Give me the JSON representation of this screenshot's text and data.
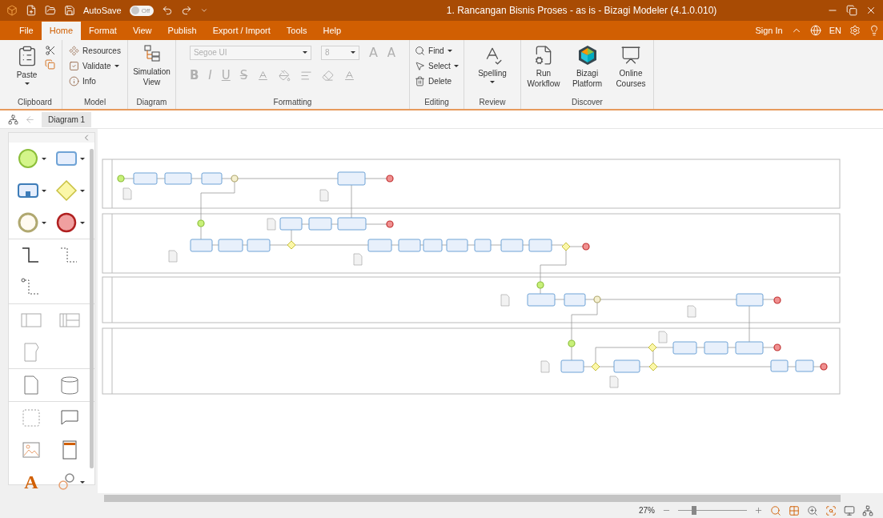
{
  "title_bar": {
    "autosave": {
      "label": "AutoSave",
      "on": false,
      "state": "Off"
    },
    "title": "1. Rancangan Bisnis Proses - as is - Bizagi Modeler (4.1.0.010)"
  },
  "menu_tabs": [
    {
      "label": "File",
      "selected": false
    },
    {
      "label": "Home",
      "selected": true
    },
    {
      "label": "Format",
      "selected": false
    },
    {
      "label": "View",
      "selected": false
    },
    {
      "label": "Publish",
      "selected": false
    },
    {
      "label": "Export / Import",
      "selected": false
    },
    {
      "label": "Tools",
      "selected": false
    },
    {
      "label": "Help",
      "selected": false
    }
  ],
  "account": {
    "sign_in": "Sign In",
    "language": "EN"
  },
  "ribbon": {
    "clipboard": {
      "label": "Clipboard",
      "paste": "Paste"
    },
    "model": {
      "label": "Model",
      "buttons": [
        "Resources",
        "Validate",
        "Info"
      ]
    },
    "diagram": {
      "label": "Diagram",
      "simulation_view": "Simulation View"
    },
    "formatting": {
      "label": "Formatting",
      "disabled": true,
      "font": "Segoe UI",
      "size": "8",
      "grow_glyph": "A",
      "shrink_glyph": "A",
      "styles": [
        "B",
        "I",
        "U",
        "S"
      ]
    },
    "editing": {
      "label": "Editing",
      "buttons": [
        "Find",
        "Select",
        "Delete"
      ]
    },
    "review": {
      "label": "Review",
      "spelling": "Spelling"
    },
    "discover": {
      "label": "Discover",
      "buttons": [
        "Run Workflow",
        "Bizagi Platform",
        "Online Courses"
      ]
    }
  },
  "document_tabs": [
    {
      "label": "Diagram 1",
      "selected": true
    }
  ],
  "palette": {
    "text_tool": "A"
  },
  "status_bar": {
    "zoom": "27%",
    "zoom_slider": {
      "level": 0.2
    }
  }
}
